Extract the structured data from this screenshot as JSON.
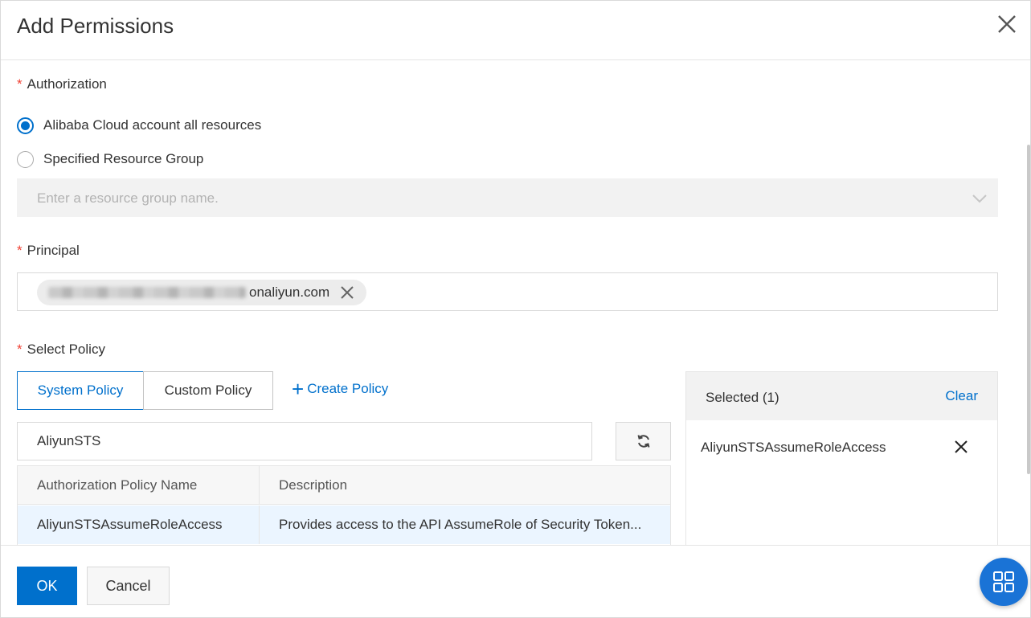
{
  "dialog": {
    "title": "Add Permissions"
  },
  "authorization": {
    "label": "Authorization",
    "required_mark": "*",
    "options": [
      {
        "label": "Alibaba Cloud account all resources",
        "checked": true
      },
      {
        "label": "Specified Resource Group",
        "checked": false
      }
    ],
    "resource_group_placeholder": "Enter a resource group name."
  },
  "principal": {
    "label": "Principal",
    "required_mark": "*",
    "tag_suffix": "onaliyun.com"
  },
  "select_policy": {
    "label": "Select Policy",
    "required_mark": "*",
    "tabs": [
      {
        "label": "System Policy",
        "active": true
      },
      {
        "label": "Custom Policy",
        "active": false
      }
    ],
    "create_link_plus": "+",
    "create_link": "Create Policy",
    "search_value": "AliyunSTS",
    "table": {
      "columns": [
        "Authorization Policy Name",
        "Description"
      ],
      "rows": [
        {
          "name": "AliyunSTSAssumeRoleAccess",
          "description": "Provides access to the API AssumeRole of Security Token..."
        }
      ]
    }
  },
  "selected": {
    "title": "Selected (1)",
    "clear_label": "Clear",
    "items": [
      "AliyunSTSAssumeRoleAccess"
    ]
  },
  "footer": {
    "ok_label": "OK",
    "cancel_label": "Cancel"
  },
  "icons": {
    "close": "close-icon",
    "chevron": "chevron-down-icon",
    "refresh": "refresh-icon",
    "remove": "remove-icon",
    "grid": "grid-icon"
  },
  "colors": {
    "accent": "#0070cc",
    "required": "#f04134",
    "row_highlight": "#ebf5ff",
    "float_button": "#1a73d6"
  }
}
